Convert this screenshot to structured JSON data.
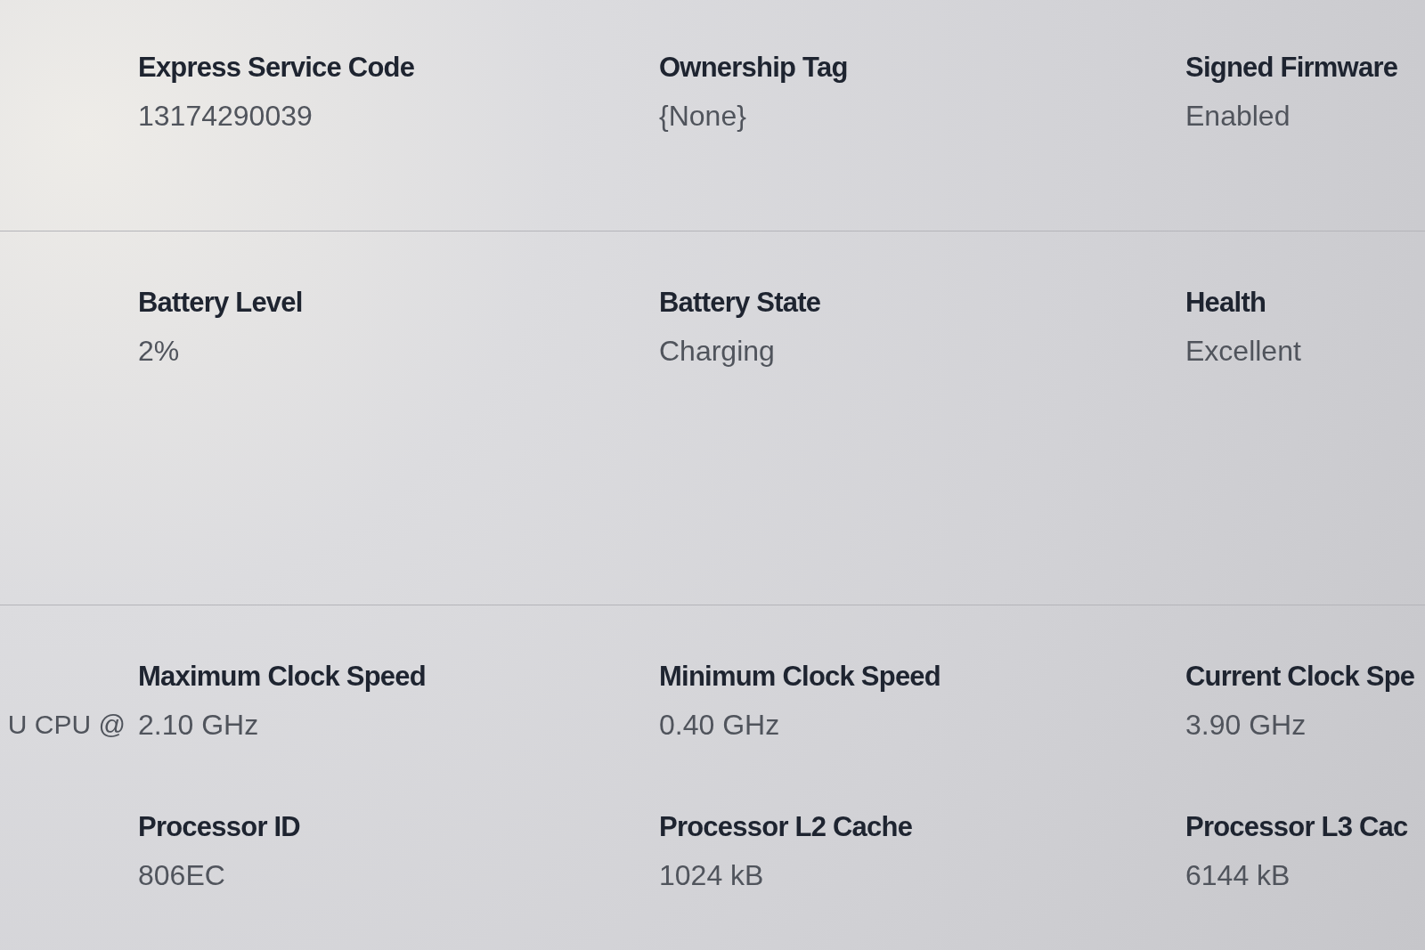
{
  "sections": [
    {
      "rows": [
        {
          "fields": [
            {
              "label": "Express Service Code",
              "value": "13174290039"
            },
            {
              "label": "Ownership Tag",
              "value": "{None}"
            },
            {
              "label": "Signed Firmware",
              "value": "Enabled"
            }
          ]
        }
      ]
    },
    {
      "rows": [
        {
          "fields": [
            {
              "label": "Battery Level",
              "value": "2%"
            },
            {
              "label": "Battery State",
              "value": "Charging"
            },
            {
              "label": "Health",
              "value": "Excellent"
            }
          ]
        }
      ]
    },
    {
      "rows": [
        {
          "clipped_value": "U CPU @",
          "fields": [
            {
              "label": "Maximum Clock Speed",
              "value": "2.10 GHz"
            },
            {
              "label": "Minimum Clock Speed",
              "value": "0.40 GHz"
            },
            {
              "label": "Current Clock Spe",
              "value": "3.90 GHz"
            }
          ]
        },
        {
          "fields": [
            {
              "label": "Processor ID",
              "value": "806EC"
            },
            {
              "label": "Processor L2 Cache",
              "value": "1024 kB"
            },
            {
              "label": "Processor L3 Cac",
              "value": "6144 kB"
            }
          ]
        }
      ]
    }
  ]
}
